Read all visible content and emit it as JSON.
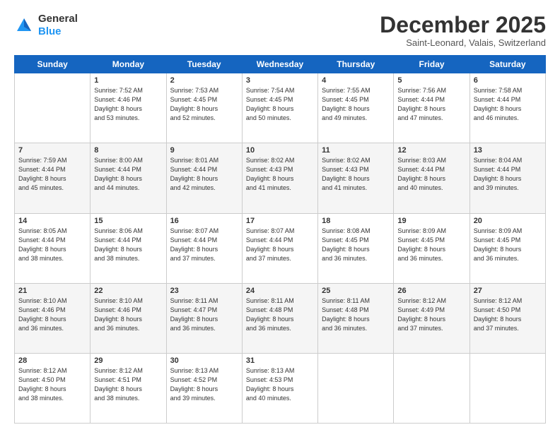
{
  "header": {
    "logo_line1": "General",
    "logo_line2": "Blue",
    "month": "December 2025",
    "location": "Saint-Leonard, Valais, Switzerland"
  },
  "days_of_week": [
    "Sunday",
    "Monday",
    "Tuesday",
    "Wednesday",
    "Thursday",
    "Friday",
    "Saturday"
  ],
  "weeks": [
    [
      {
        "num": "",
        "info": ""
      },
      {
        "num": "1",
        "info": "Sunrise: 7:52 AM\nSunset: 4:46 PM\nDaylight: 8 hours\nand 53 minutes."
      },
      {
        "num": "2",
        "info": "Sunrise: 7:53 AM\nSunset: 4:45 PM\nDaylight: 8 hours\nand 52 minutes."
      },
      {
        "num": "3",
        "info": "Sunrise: 7:54 AM\nSunset: 4:45 PM\nDaylight: 8 hours\nand 50 minutes."
      },
      {
        "num": "4",
        "info": "Sunrise: 7:55 AM\nSunset: 4:45 PM\nDaylight: 8 hours\nand 49 minutes."
      },
      {
        "num": "5",
        "info": "Sunrise: 7:56 AM\nSunset: 4:44 PM\nDaylight: 8 hours\nand 47 minutes."
      },
      {
        "num": "6",
        "info": "Sunrise: 7:58 AM\nSunset: 4:44 PM\nDaylight: 8 hours\nand 46 minutes."
      }
    ],
    [
      {
        "num": "7",
        "info": "Sunrise: 7:59 AM\nSunset: 4:44 PM\nDaylight: 8 hours\nand 45 minutes."
      },
      {
        "num": "8",
        "info": "Sunrise: 8:00 AM\nSunset: 4:44 PM\nDaylight: 8 hours\nand 44 minutes."
      },
      {
        "num": "9",
        "info": "Sunrise: 8:01 AM\nSunset: 4:44 PM\nDaylight: 8 hours\nand 42 minutes."
      },
      {
        "num": "10",
        "info": "Sunrise: 8:02 AM\nSunset: 4:43 PM\nDaylight: 8 hours\nand 41 minutes."
      },
      {
        "num": "11",
        "info": "Sunrise: 8:02 AM\nSunset: 4:43 PM\nDaylight: 8 hours\nand 41 minutes."
      },
      {
        "num": "12",
        "info": "Sunrise: 8:03 AM\nSunset: 4:44 PM\nDaylight: 8 hours\nand 40 minutes."
      },
      {
        "num": "13",
        "info": "Sunrise: 8:04 AM\nSunset: 4:44 PM\nDaylight: 8 hours\nand 39 minutes."
      }
    ],
    [
      {
        "num": "14",
        "info": "Sunrise: 8:05 AM\nSunset: 4:44 PM\nDaylight: 8 hours\nand 38 minutes."
      },
      {
        "num": "15",
        "info": "Sunrise: 8:06 AM\nSunset: 4:44 PM\nDaylight: 8 hours\nand 38 minutes."
      },
      {
        "num": "16",
        "info": "Sunrise: 8:07 AM\nSunset: 4:44 PM\nDaylight: 8 hours\nand 37 minutes."
      },
      {
        "num": "17",
        "info": "Sunrise: 8:07 AM\nSunset: 4:44 PM\nDaylight: 8 hours\nand 37 minutes."
      },
      {
        "num": "18",
        "info": "Sunrise: 8:08 AM\nSunset: 4:45 PM\nDaylight: 8 hours\nand 36 minutes."
      },
      {
        "num": "19",
        "info": "Sunrise: 8:09 AM\nSunset: 4:45 PM\nDaylight: 8 hours\nand 36 minutes."
      },
      {
        "num": "20",
        "info": "Sunrise: 8:09 AM\nSunset: 4:45 PM\nDaylight: 8 hours\nand 36 minutes."
      }
    ],
    [
      {
        "num": "21",
        "info": "Sunrise: 8:10 AM\nSunset: 4:46 PM\nDaylight: 8 hours\nand 36 minutes."
      },
      {
        "num": "22",
        "info": "Sunrise: 8:10 AM\nSunset: 4:46 PM\nDaylight: 8 hours\nand 36 minutes."
      },
      {
        "num": "23",
        "info": "Sunrise: 8:11 AM\nSunset: 4:47 PM\nDaylight: 8 hours\nand 36 minutes."
      },
      {
        "num": "24",
        "info": "Sunrise: 8:11 AM\nSunset: 4:48 PM\nDaylight: 8 hours\nand 36 minutes."
      },
      {
        "num": "25",
        "info": "Sunrise: 8:11 AM\nSunset: 4:48 PM\nDaylight: 8 hours\nand 36 minutes."
      },
      {
        "num": "26",
        "info": "Sunrise: 8:12 AM\nSunset: 4:49 PM\nDaylight: 8 hours\nand 37 minutes."
      },
      {
        "num": "27",
        "info": "Sunrise: 8:12 AM\nSunset: 4:50 PM\nDaylight: 8 hours\nand 37 minutes."
      }
    ],
    [
      {
        "num": "28",
        "info": "Sunrise: 8:12 AM\nSunset: 4:50 PM\nDaylight: 8 hours\nand 38 minutes."
      },
      {
        "num": "29",
        "info": "Sunrise: 8:12 AM\nSunset: 4:51 PM\nDaylight: 8 hours\nand 38 minutes."
      },
      {
        "num": "30",
        "info": "Sunrise: 8:13 AM\nSunset: 4:52 PM\nDaylight: 8 hours\nand 39 minutes."
      },
      {
        "num": "31",
        "info": "Sunrise: 8:13 AM\nSunset: 4:53 PM\nDaylight: 8 hours\nand 40 minutes."
      },
      {
        "num": "",
        "info": ""
      },
      {
        "num": "",
        "info": ""
      },
      {
        "num": "",
        "info": ""
      }
    ]
  ]
}
